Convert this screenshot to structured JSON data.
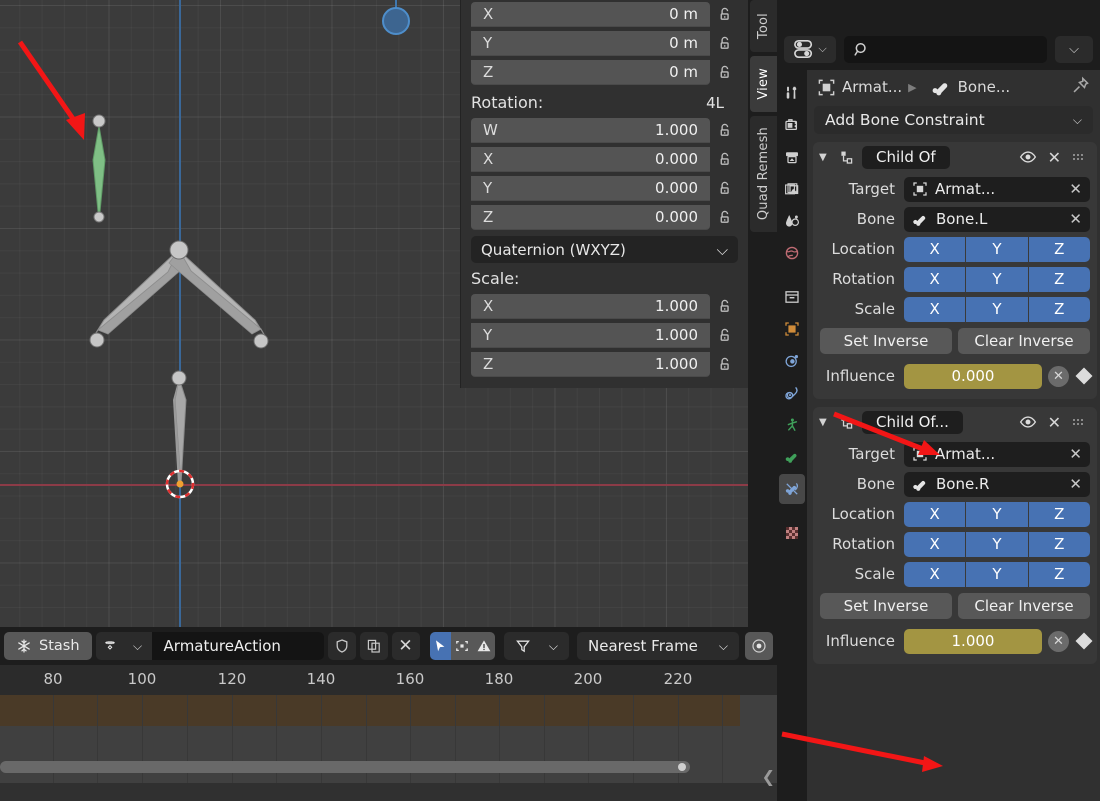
{
  "viewport": {
    "name": "3d-viewport",
    "tabs": [
      {
        "label": "Tool",
        "active": false
      },
      {
        "label": "View",
        "active": true
      },
      {
        "label": "Quad Remesh",
        "active": false
      }
    ],
    "buttons": [
      {
        "name": "zoom-icon",
        "label": ""
      },
      {
        "name": "hand-pan-icon",
        "label": ""
      },
      {
        "name": "camera-icon",
        "label": ""
      },
      {
        "name": "grid-ortho-icon",
        "label": ""
      }
    ]
  },
  "sidebar": {
    "location": {
      "rows": [
        {
          "axis": "X",
          "value": "0 m"
        },
        {
          "axis": "Y",
          "value": "0 m"
        },
        {
          "axis": "Z",
          "value": "0 m"
        }
      ]
    },
    "rotation": {
      "title": "Rotation:",
      "badge": "4L",
      "rows": [
        {
          "axis": "W",
          "value": "1.000"
        },
        {
          "axis": "X",
          "value": "0.000"
        },
        {
          "axis": "Y",
          "value": "0.000"
        },
        {
          "axis": "Z",
          "value": "0.000"
        }
      ],
      "mode": "Quaternion (WXYZ)"
    },
    "scale": {
      "title": "Scale:",
      "rows": [
        {
          "axis": "X",
          "value": "1.000"
        },
        {
          "axis": "Y",
          "value": "1.000"
        },
        {
          "axis": "Z",
          "value": "1.000"
        }
      ]
    }
  },
  "dopesheet": {
    "stash_label": "Stash",
    "action_name": "ArmatureAction",
    "snap_mode": "Nearest Frame",
    "ruler": {
      "labels": [
        "80",
        "100",
        "120",
        "140",
        "160",
        "180",
        "200",
        "220"
      ],
      "positions": [
        53,
        142,
        232,
        321,
        410,
        499,
        588,
        678
      ]
    }
  },
  "properties": {
    "search_placeholder": "",
    "breadcrumb": {
      "object": "Armat...",
      "bone": "Bone..."
    },
    "add_constraint_label": "Add Bone Constraint",
    "tabs": [
      {
        "name": "tool-tab",
        "active": false
      },
      {
        "name": "render-tab",
        "active": false
      },
      {
        "name": "output-tab",
        "active": false
      },
      {
        "name": "view-layer-tab",
        "active": false
      },
      {
        "name": "scene-tab",
        "active": false
      },
      {
        "name": "world-tab",
        "active": false
      },
      {
        "name": "collection-tab",
        "active": false
      },
      {
        "name": "object-tab",
        "active": false
      },
      {
        "name": "modifier-tab",
        "active": false
      },
      {
        "name": "particles-tab",
        "active": false
      },
      {
        "name": "physics-tab",
        "active": false
      },
      {
        "name": "object-constraint-tab",
        "active": false
      },
      {
        "name": "armature-data-tab",
        "active": false
      },
      {
        "name": "bone-tab",
        "active": false
      },
      {
        "name": "bone-constraint-tab",
        "active": true
      },
      {
        "name": "material-tab",
        "active": false
      },
      {
        "name": "texture-tab",
        "active": false
      }
    ],
    "constraints": [
      {
        "title": "Child Of",
        "target_label": "Target",
        "target_value": "Armat...",
        "bone_label": "Bone",
        "bone_value": "Bone.L",
        "location_label": "Location",
        "rotation_label": "Rotation",
        "scale_label": "Scale",
        "axes": [
          "X",
          "Y",
          "Z"
        ],
        "set_inverse": "Set Inverse",
        "clear_inverse": "Clear Inverse",
        "influence_label": "Influence",
        "influence_value": "0.000",
        "influence_fill_pct": 0
      },
      {
        "title": "Child Of...",
        "target_label": "Target",
        "target_value": "Armat...",
        "bone_label": "Bone",
        "bone_value": "Bone.R",
        "location_label": "Location",
        "rotation_label": "Rotation",
        "scale_label": "Scale",
        "axes": [
          "X",
          "Y",
          "Z"
        ],
        "set_inverse": "Set Inverse",
        "clear_inverse": "Clear Inverse",
        "influence_label": "Influence",
        "influence_value": "1.000",
        "influence_fill_pct": 100
      }
    ]
  },
  "colors": {
    "accent_blue": "#4772b3",
    "influence_yellow": "#a39542",
    "panel_bg": "#303030",
    "viewport_bg": "#3b3b3b",
    "bone_selected_green": "#7fbf85",
    "annotation_red": "#f21616"
  }
}
